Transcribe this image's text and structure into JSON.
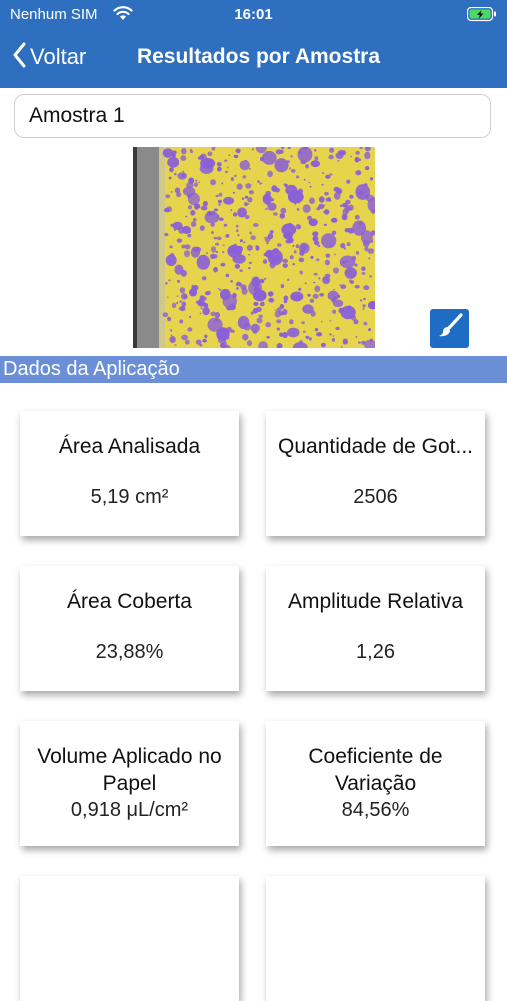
{
  "status_bar": {
    "carrier": "Nenhum SIM",
    "time": "16:01"
  },
  "nav": {
    "back_label": "Voltar",
    "title": "Resultados por Amostra"
  },
  "sample": {
    "selected": "Amostra 1"
  },
  "section": {
    "title": "Dados da Aplicação"
  },
  "cards": [
    {
      "title": "Área Analisada",
      "value": "5,19 cm²"
    },
    {
      "title": "Quantidade de Got...",
      "value": "2506"
    },
    {
      "title": "Área Coberta",
      "value": "23,88%"
    },
    {
      "title": "Amplitude Relativa",
      "value": "1,26"
    },
    {
      "title": "Volume Aplicado no Papel",
      "value": "0,918 μL/cm²"
    },
    {
      "title": "Coeficiente de Variação",
      "value": "84,56%"
    }
  ],
  "colors": {
    "nav_bar": "#2e6fc0",
    "section_header": "#6b8fd6",
    "edit_button": "#1e6cc4",
    "paper_yellow": "#e8d64a",
    "droplet_purple": "#8a5fd8",
    "battery_charging": "#4cd964"
  },
  "icons": [
    "wifi-icon",
    "battery-charging-icon",
    "chevron-left-icon",
    "paintbrush-icon"
  ]
}
